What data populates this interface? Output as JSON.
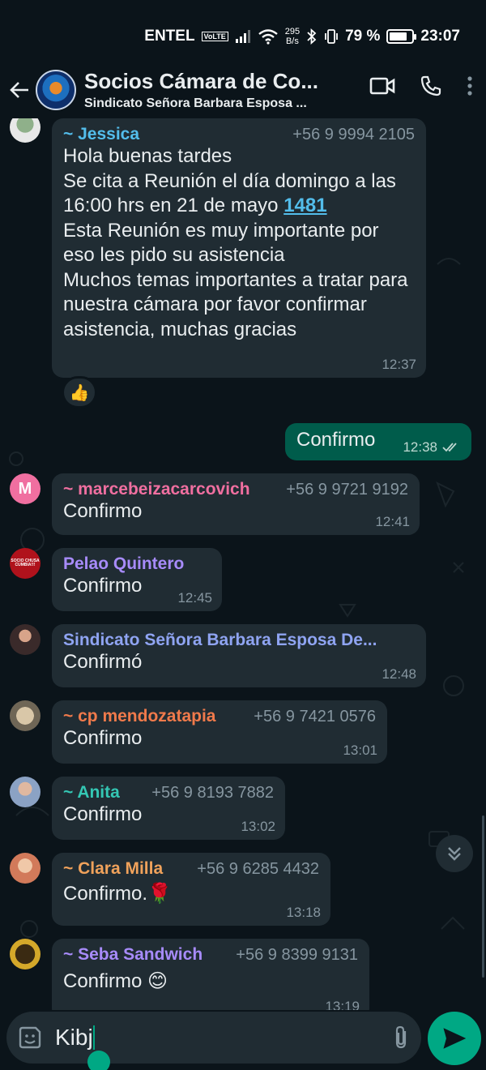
{
  "status_bar": {
    "carrier": "ENTEL",
    "volte_badge": "VoLTE",
    "network_speed_value": "295",
    "network_speed_unit": "B/s",
    "battery": "79 %",
    "battery_level": 0.79,
    "time": "23:07"
  },
  "header": {
    "title": "Socios Cámara de Co...",
    "subtitle": "Sindicato Señora Barbara Esposa ..."
  },
  "messages": [
    {
      "sender": "~ Jessica",
      "phone": "+56 9 9994 2105",
      "sender_color": "#53bdeb",
      "text_before_link": "Hola buenas tardes\nSe cita a Reunión el día domingo a las 16:00 hrs en 21 de mayo ",
      "link": "1481",
      "text_after_link": "\nEsta Reunión es muy importante por eso les pido su asistencia\nMuchos temas importantes a tratar para nuestra cámara por favor confirmar asistencia, muchas gracias",
      "time": "12:37",
      "reaction": "👍"
    },
    {
      "outgoing": true,
      "text": "Confirmo",
      "time": "12:38"
    },
    {
      "sender": "~ marcebeizacarcovich",
      "phone": "+56 9 9721 9192",
      "sender_color": "#f06fa0",
      "avatar_letter": "M",
      "text": "Confirmo",
      "time": "12:41"
    },
    {
      "sender": "Pelao Quintero",
      "phone": "",
      "sender_color": "#a78bfa",
      "avatar_caption": "SOCIO CHUSA CUMBIA!!!",
      "text": "Confirmo",
      "time": "12:45"
    },
    {
      "sender": "Sindicato Señora Barbara Esposa De...",
      "phone": "",
      "sender_color": "#8fa4f2",
      "text": "Confirmó",
      "time": "12:48"
    },
    {
      "sender": "~ cp mendozatapia",
      "phone": "+56 9 7421 0576",
      "sender_color": "#f07a4b",
      "text": "Confirmo",
      "time": "13:01"
    },
    {
      "sender": "~ Anita",
      "phone": "+56 9 8193 7882",
      "sender_color": "#34c7b4",
      "text": "Confirmo",
      "time": "13:02"
    },
    {
      "sender": "~ Clara Milla",
      "phone": "+56 9 6285 4432",
      "sender_color": "#f0a25b",
      "text": "Confirmo.🌹",
      "time": "13:18"
    },
    {
      "sender": "~ Seba Sandwich",
      "phone": "+56 9 8399 9131",
      "sender_color": "#a78bfa",
      "text": "Confirmo 😊",
      "time": "13:19"
    }
  ],
  "composer": {
    "value": "Kibj"
  }
}
